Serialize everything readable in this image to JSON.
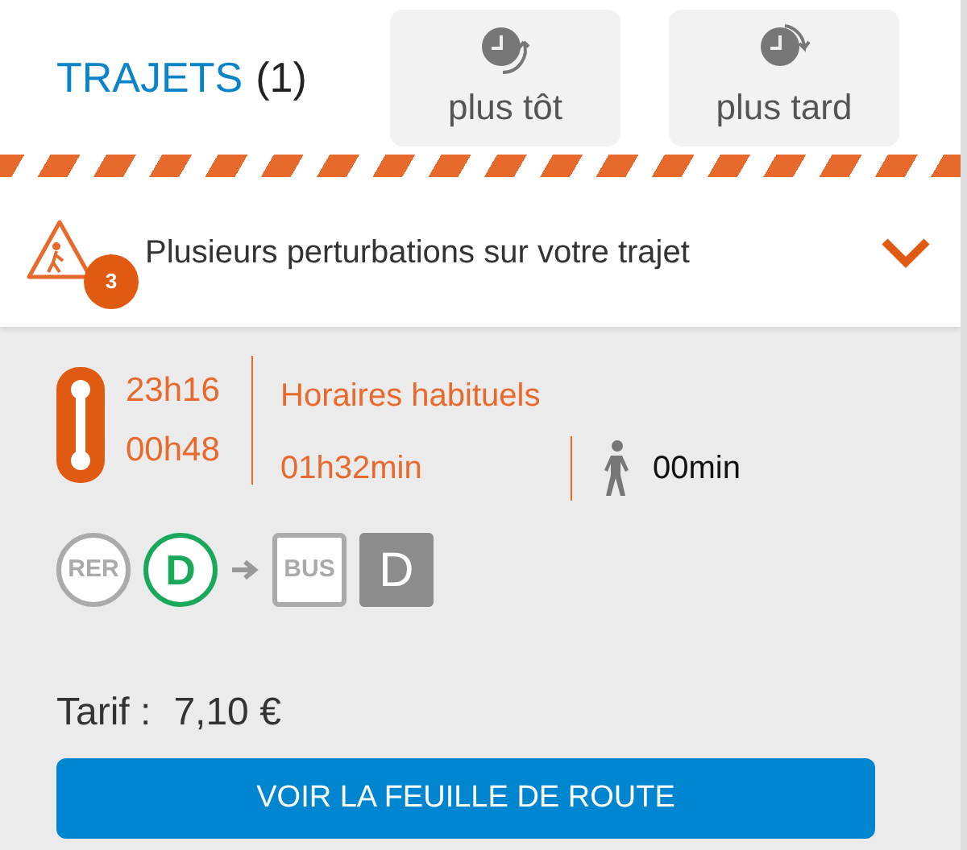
{
  "header": {
    "title": "TRAJETS",
    "count": "(1)"
  },
  "time_buttons": [
    {
      "label": "plus tôt",
      "kind": "earlier"
    },
    {
      "label": "plus tard",
      "kind": "later"
    }
  ],
  "alert": {
    "text": "Plusieurs perturbations sur votre trajet",
    "count": "3",
    "expanded": false
  },
  "journey": {
    "departure": "23h16",
    "arrival": "00h48",
    "schedule": "Horaires habituels",
    "duration": "01h32min",
    "walk": "00min",
    "lines": [
      {
        "kind": "mode-circle",
        "label": "RER",
        "color": "#aaaaaa"
      },
      {
        "kind": "line-circle",
        "label": "D",
        "color": "#1aa85c"
      },
      {
        "kind": "mode-square",
        "label": "BUS",
        "color": "#aaaaaa"
      },
      {
        "kind": "line-square",
        "label": "D",
        "color": "#8c8c8c"
      }
    ]
  },
  "fare": {
    "label": "Tarif :",
    "value": "7,10 €"
  },
  "action_button": "VOIR LA FEUILLE DE ROUTE"
}
